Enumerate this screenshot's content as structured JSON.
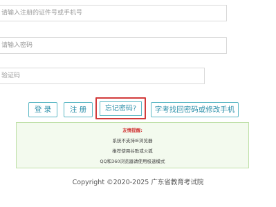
{
  "form": {
    "id_placeholder": "请输入注册的证件号或手机号",
    "password_placeholder": "请输入密码",
    "captcha_placeholder": "验证码"
  },
  "buttons": {
    "login": "登 录",
    "register": "注 册",
    "forgot_password": "忘记密码?",
    "recover_candidate": "字考找回密码或修改手机"
  },
  "notice": {
    "title": "友情提醒:",
    "lines": [
      "系统不支持IE浏览器",
      "推荐使用谷歌或火狐",
      "QQ和360浏览器请使用极速模式"
    ]
  },
  "footer": {
    "copyright": "Copyright ©2020-2025 广东省教育考试院"
  },
  "colors": {
    "button_border": "#5bb7c4",
    "button_text": "#2a8ea8",
    "highlight_border": "#d23a3a",
    "notice_bg": "#f3faee",
    "notice_border": "#bfe0a8"
  }
}
